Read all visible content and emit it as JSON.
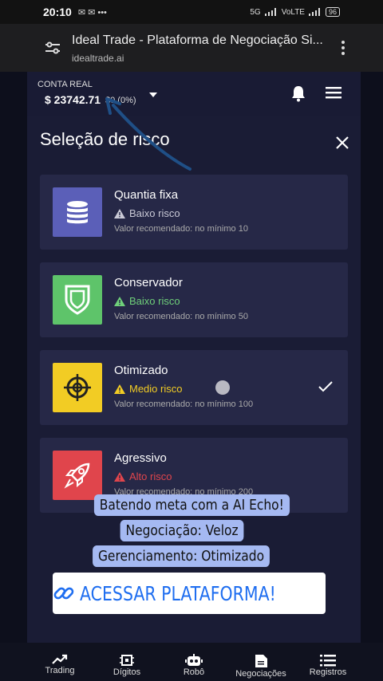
{
  "status_bar": {
    "time": "20:10",
    "left_icons": "✉ ✉ •••",
    "network": "5G",
    "network_sub": "VoLTE",
    "battery": "96"
  },
  "browser": {
    "title": "Ideal Trade - Plataforma de Negociação Si...",
    "url": "idealtrade.ai"
  },
  "account": {
    "label": "CONTA REAL",
    "balance": "$ 23742.71",
    "delta": "$0 (0%)"
  },
  "modal": {
    "title": "Seleção de risco",
    "options": [
      {
        "name": "Quantia fixa",
        "risk": "Baixo risco",
        "recommended": "Valor recomendado: no mínimo 10",
        "icon": "coins-stack-icon",
        "icon_bg": "#5b5fb8",
        "risk_color": "#c9c9d6"
      },
      {
        "name": "Conservador",
        "risk": "Baixo risco",
        "recommended": "Valor recomendado: no mínimo 50",
        "icon": "shield-icon",
        "icon_bg": "#5ec46a",
        "risk_color": "#6fd07a"
      },
      {
        "name": "Otimizado",
        "risk": "Medio risco",
        "recommended": "Valor recomendado: no mínimo 100",
        "icon": "crosshair-icon",
        "icon_bg": "#f2cc24",
        "risk_color": "#f2cc24",
        "selected": true
      },
      {
        "name": "Agressivo",
        "risk": "Alto risco",
        "recommended": "Valor recomendado: no mínimo 200",
        "icon": "rocket-icon",
        "icon_bg": "#e0454c",
        "risk_color": "#e0454c"
      }
    ]
  },
  "story_overlay": {
    "line1": "Batendo meta com a AI Echo!",
    "line2": "Negociação: Veloz",
    "line3": "Gerenciamento: Otimizado",
    "cta": "ACESSAR PLATAFORMA!"
  },
  "bottom_nav": [
    {
      "label": "Trading",
      "icon": "chart-trend-icon"
    },
    {
      "label": "Dígitos",
      "icon": "chip-icon"
    },
    {
      "label": "Robô",
      "icon": "robot-icon"
    },
    {
      "label": "Negociações",
      "icon": "document-icon"
    },
    {
      "label": "Registros",
      "icon": "list-icon"
    }
  ]
}
